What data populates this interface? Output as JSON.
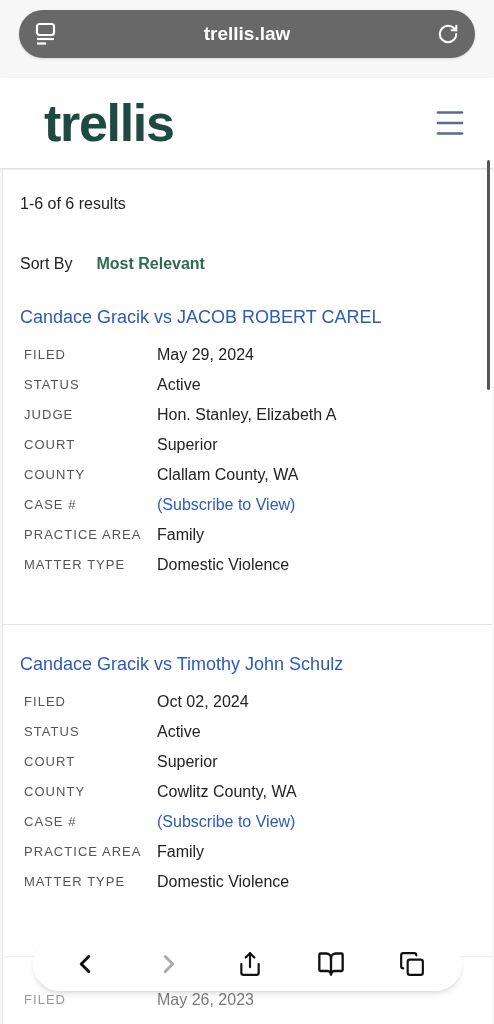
{
  "browser": {
    "url": "trellis.law"
  },
  "header": {
    "logo": "trellis"
  },
  "results": {
    "summary": "1-6 of 6 results",
    "sort_label": "Sort By",
    "sort_value": "Most Relevant"
  },
  "cases": [
    {
      "title": "Candace Gracik vs JACOB ROBERT CAREL",
      "fields": [
        {
          "label": "FILED",
          "value": "May 29, 2024",
          "kind": "text"
        },
        {
          "label": "STATUS",
          "value": "Active",
          "kind": "text"
        },
        {
          "label": "JUDGE",
          "value": "Hon. Stanley, Elizabeth A",
          "kind": "text"
        },
        {
          "label": "COURT",
          "value": "Superior",
          "kind": "text"
        },
        {
          "label": "COUNTY",
          "value": "Clallam County, WA",
          "kind": "text"
        },
        {
          "label": "CASE #",
          "value": "(Subscribe to View)",
          "kind": "link"
        },
        {
          "label": "PRACTICE AREA",
          "value": "Family",
          "kind": "text"
        },
        {
          "label": "MATTER TYPE",
          "value": "Domestic Violence",
          "kind": "text"
        }
      ]
    },
    {
      "title": "Candace Gracik vs Timothy John Schulz",
      "fields": [
        {
          "label": "FILED",
          "value": "Oct 02, 2024",
          "kind": "text"
        },
        {
          "label": "STATUS",
          "value": "Active",
          "kind": "text"
        },
        {
          "label": "COURT",
          "value": "Superior",
          "kind": "text"
        },
        {
          "label": "COUNTY",
          "value": "Cowlitz County, WA",
          "kind": "text"
        },
        {
          "label": "CASE #",
          "value": "(Subscribe to View)",
          "kind": "link"
        },
        {
          "label": "PRACTICE AREA",
          "value": "Family",
          "kind": "text"
        },
        {
          "label": "MATTER TYPE",
          "value": "Domestic Violence",
          "kind": "text"
        }
      ]
    },
    {
      "fields": [
        {
          "label": "FILED",
          "value": "May 26, 2023",
          "kind": "text"
        }
      ]
    }
  ],
  "toolbar": {
    "forward_disabled": true
  }
}
